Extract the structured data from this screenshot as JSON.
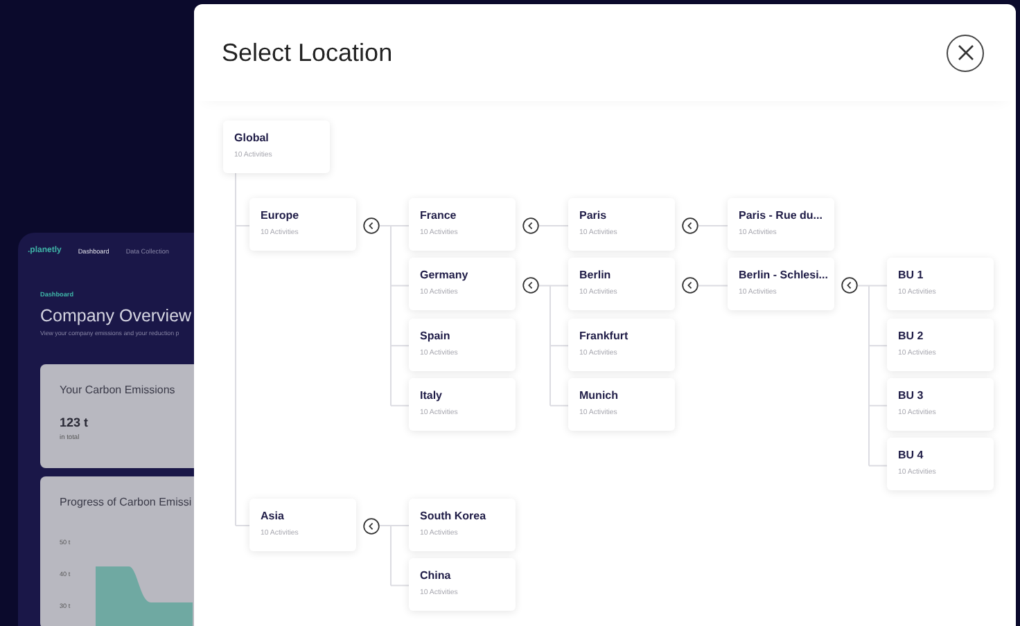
{
  "background": {
    "logo": ".planetly",
    "nav": [
      {
        "label": "Dashboard",
        "selected": true
      },
      {
        "label": "Data Collection",
        "selected": false
      }
    ],
    "breadcrumb": "Dashboard",
    "title": "Company Overview",
    "subtitle": "View your company emissions and your reduction p",
    "emissions_card": {
      "title": "Your Carbon Emissions",
      "value": "123 t",
      "caption": "in total"
    },
    "progress_card": {
      "title": "Progress of Carbon Emissi",
      "y_ticks": [
        "50 t",
        "40 t",
        "30 t"
      ]
    }
  },
  "dialog": {
    "title": "Select Location",
    "tree": {
      "name": "Global",
      "activities": "10 Activities",
      "children": [
        {
          "name": "Europe",
          "activities": "10 Activities",
          "children": [
            {
              "name": "France",
              "activities": "10 Activities",
              "children": [
                {
                  "name": "Paris",
                  "activities": "10 Activities",
                  "children": [
                    {
                      "name": "Paris - Rue du...",
                      "activities": "10 Activities"
                    }
                  ]
                }
              ]
            },
            {
              "name": "Germany",
              "activities": "10 Activities",
              "children": [
                {
                  "name": "Berlin",
                  "activities": "10 Activities",
                  "children": [
                    {
                      "name": "Berlin - Schlesi...",
                      "activities": "10 Activities",
                      "children": [
                        {
                          "name": "BU 1",
                          "activities": "10 Activities"
                        },
                        {
                          "name": "BU 2",
                          "activities": "10 Activities"
                        },
                        {
                          "name": "BU 3",
                          "activities": "10 Activities"
                        },
                        {
                          "name": "BU 4",
                          "activities": "10 Activities"
                        }
                      ]
                    }
                  ]
                },
                {
                  "name": "Frankfurt",
                  "activities": "10 Activities"
                },
                {
                  "name": "Munich",
                  "activities": "10 Activities"
                }
              ]
            },
            {
              "name": "Spain",
              "activities": "10 Activities"
            },
            {
              "name": "Italy",
              "activities": "10 Activities"
            }
          ]
        },
        {
          "name": "Asia",
          "activities": "10 Activities",
          "children": [
            {
              "name": "South Korea",
              "activities": "10 Activities"
            },
            {
              "name": "China",
              "activities": "10 Activities"
            }
          ]
        }
      ]
    }
  }
}
